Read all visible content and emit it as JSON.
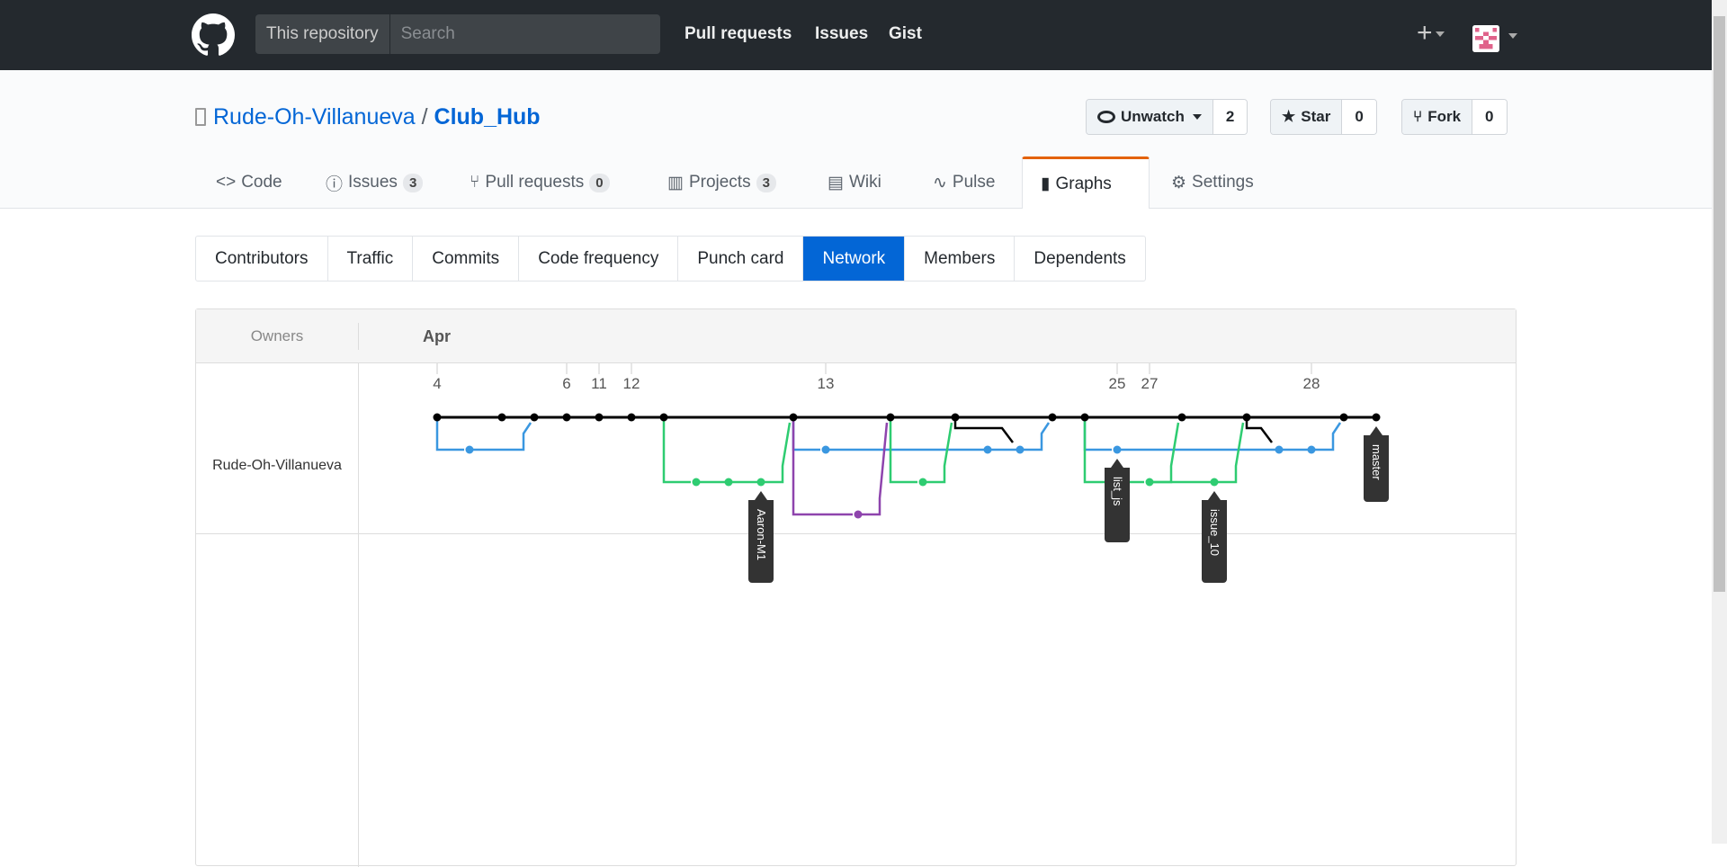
{
  "nav": {
    "scope": "This repository",
    "search_placeholder": "Search",
    "links": [
      "Pull requests",
      "Issues",
      "Gist"
    ],
    "plus": "+"
  },
  "repo": {
    "owner": "Rude-Oh-Villanueva",
    "sep": "/",
    "name": "Club_Hub",
    "watch": {
      "label": "Unwatch",
      "count": "2"
    },
    "star": {
      "label": "Star",
      "count": "0"
    },
    "fork": {
      "label": "Fork",
      "count": "0"
    }
  },
  "tabs": [
    {
      "label": "Code"
    },
    {
      "label": "Issues",
      "count": "3"
    },
    {
      "label": "Pull requests",
      "count": "0"
    },
    {
      "label": "Projects",
      "count": "3"
    },
    {
      "label": "Wiki"
    },
    {
      "label": "Pulse"
    },
    {
      "label": "Graphs",
      "selected": true
    },
    {
      "label": "Settings"
    }
  ],
  "subnav": [
    "Contributors",
    "Traffic",
    "Commits",
    "Code frequency",
    "Punch card",
    "Network",
    "Members",
    "Dependents"
  ],
  "subnav_selected": "Network",
  "network": {
    "owners_label": "Owners",
    "month": "Apr",
    "owner": "Rude-Oh-Villanueva",
    "dates": [
      {
        "label": "4",
        "commit": 0
      },
      {
        "label": "6",
        "commit": 4
      },
      {
        "label": "11",
        "commit": 5
      },
      {
        "label": "12",
        "commit": 6
      },
      {
        "label": "13",
        "commit": 12
      },
      {
        "label": "25",
        "commit": 21
      },
      {
        "label": "27",
        "commit": 22
      },
      {
        "label": "28",
        "commit": 27
      }
    ],
    "colors": {
      "master": "#000000",
      "blue": "#3a97e0",
      "green": "#2ecc71",
      "purple": "#8e44ad"
    },
    "master_commits": [
      0,
      2,
      3,
      4,
      5,
      6,
      7,
      11,
      14,
      16,
      19,
      20,
      23,
      25,
      28,
      29
    ],
    "blue_commits": [
      1,
      12,
      17,
      18,
      21,
      26,
      27
    ],
    "green_commits": [
      8,
      9,
      10,
      15,
      22,
      24
    ],
    "purple_commits": [
      13
    ],
    "labels": [
      {
        "name": "Aaron-M1",
        "commit": 10,
        "lane": "green"
      },
      {
        "name": "list_js",
        "commit": 21,
        "lane": "blue"
      },
      {
        "name": "issue_10",
        "commit": 24,
        "lane": "green"
      },
      {
        "name": "master",
        "commit": 29,
        "lane": "master"
      }
    ]
  }
}
